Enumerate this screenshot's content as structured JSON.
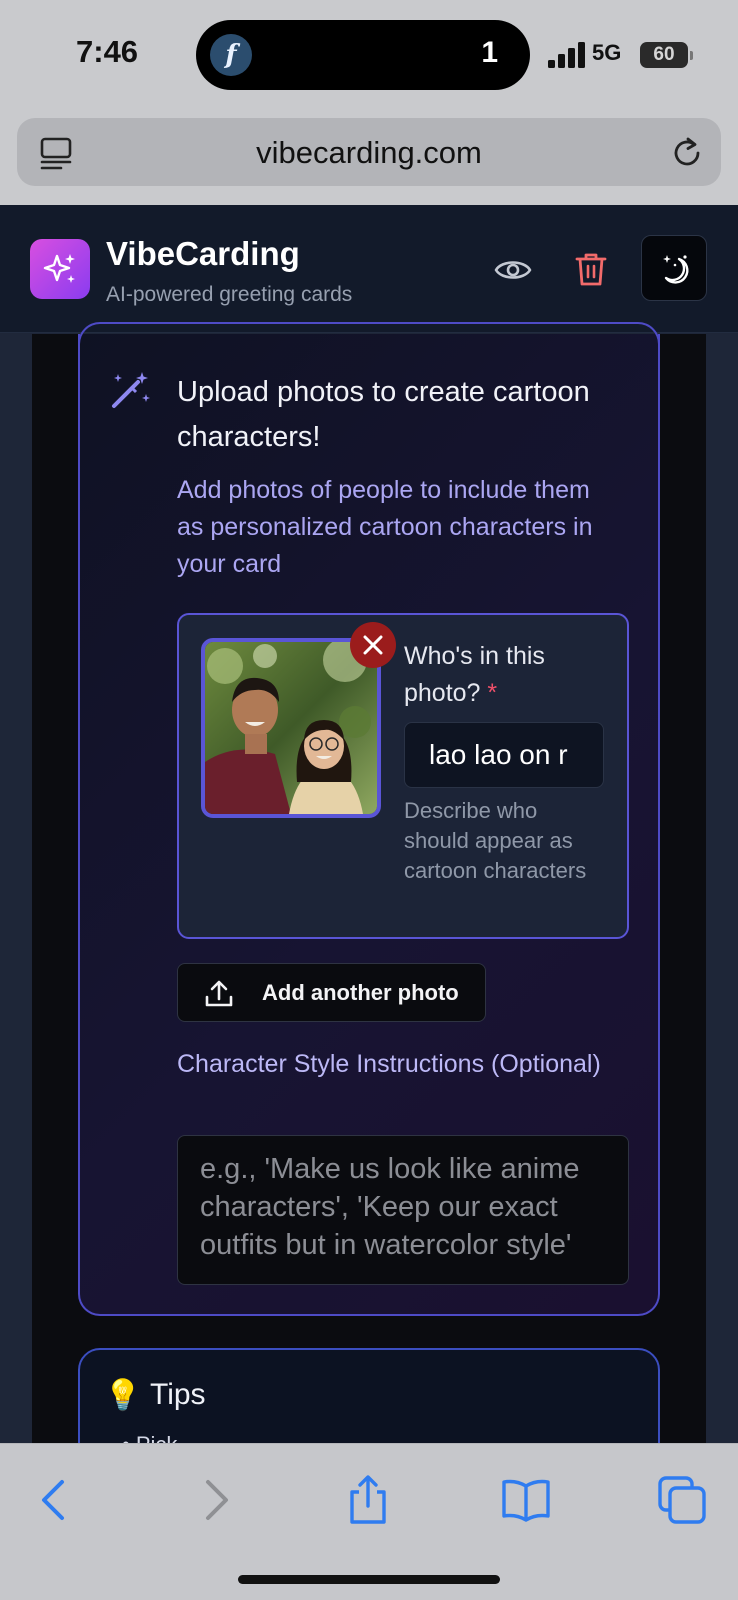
{
  "status_bar": {
    "time": "7:46",
    "island_count": "1",
    "network": "5G",
    "battery": "60"
  },
  "browser": {
    "url": "vibecarding.com",
    "toolbar": [
      "back-icon",
      "forward-icon",
      "share-icon",
      "bookmarks-icon",
      "tabs-icon"
    ]
  },
  "header": {
    "title": "VibeCarding",
    "subtitle": "AI-powered greeting cards",
    "logo_icon": "sparkles-icon",
    "actions": [
      "eye-icon",
      "trash-icon",
      "moon-stars-icon"
    ],
    "colors": {
      "logo_gradient_start": "#d84fe0",
      "logo_gradient_end": "#8a3cf0",
      "trash": "#f26b6b"
    }
  },
  "upload": {
    "title": "Upload photos to create cartoon characters!",
    "description": "Add photos of people to include them as personalized cartoon characters in your card",
    "photo": {
      "who_label": "Who's in this photo?",
      "required_mark": "*",
      "who_value": "lao lao on r",
      "help_text": "Describe who should appear as cartoon characters"
    },
    "add_photo_label": "Add another photo",
    "style_label": "Character Style Instructions (Optional)",
    "style_placeholder": "e.g., 'Make us look like anime characters', 'Keep our exact outfits but in watercolor style'",
    "accent": "#5a55d6"
  },
  "tips": {
    "icon": "💡",
    "title": "Tips",
    "peek_text": "• Pick ..."
  }
}
